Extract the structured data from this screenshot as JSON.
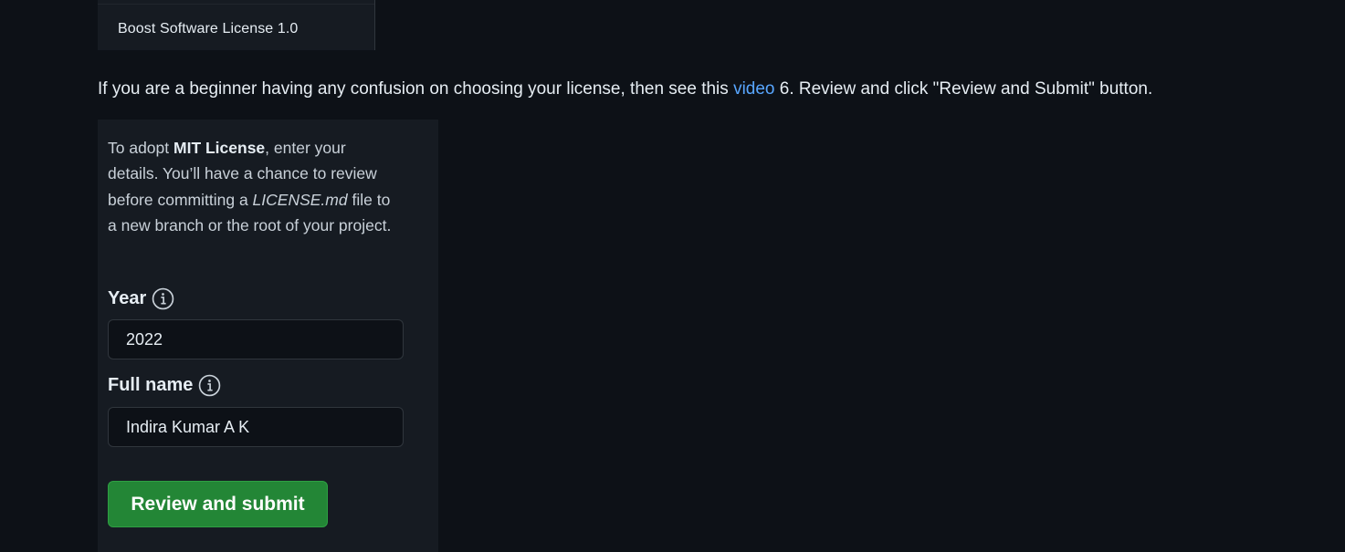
{
  "license_list": {
    "item": "Boost Software License 1.0"
  },
  "instruction": {
    "before_link": "If you are a beginner having any confusion on choosing your license, then see this ",
    "link_text": "video",
    "after_link": " 6. Review and click \"Review and Submit\" button."
  },
  "form": {
    "desc_part1": "To adopt ",
    "license_name": "MIT License",
    "desc_part2": ", enter your details. You’ll have a chance to review before committing a ",
    "file_name": "LICENSE.md",
    "desc_part3": " file to a new branch or the root of your project.",
    "year_label": "Year",
    "year_value": "2022",
    "name_label": "Full name",
    "name_value": "Indira Kumar A K",
    "submit_label": "Review and submit",
    "info_icon": "info-circle-icon"
  },
  "colors": {
    "background": "#0d1117",
    "panel": "#161b22",
    "link": "#58a6ff",
    "button": "#238636"
  }
}
